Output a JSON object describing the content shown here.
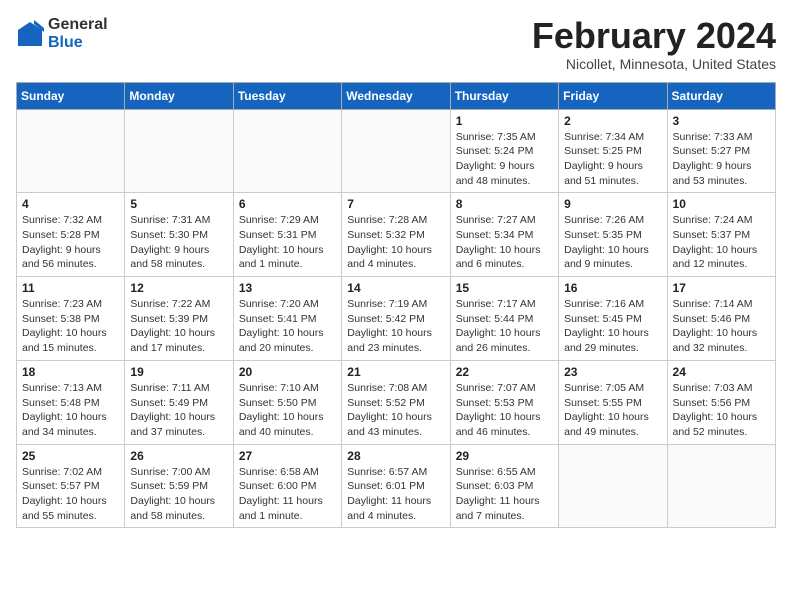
{
  "header": {
    "logo_general": "General",
    "logo_blue": "Blue",
    "month_title": "February 2024",
    "location": "Nicollet, Minnesota, United States"
  },
  "weekdays": [
    "Sunday",
    "Monday",
    "Tuesday",
    "Wednesday",
    "Thursday",
    "Friday",
    "Saturday"
  ],
  "weeks": [
    [
      {
        "day": "",
        "info": ""
      },
      {
        "day": "",
        "info": ""
      },
      {
        "day": "",
        "info": ""
      },
      {
        "day": "",
        "info": ""
      },
      {
        "day": "1",
        "info": "Sunrise: 7:35 AM\nSunset: 5:24 PM\nDaylight: 9 hours and 48 minutes."
      },
      {
        "day": "2",
        "info": "Sunrise: 7:34 AM\nSunset: 5:25 PM\nDaylight: 9 hours and 51 minutes."
      },
      {
        "day": "3",
        "info": "Sunrise: 7:33 AM\nSunset: 5:27 PM\nDaylight: 9 hours and 53 minutes."
      }
    ],
    [
      {
        "day": "4",
        "info": "Sunrise: 7:32 AM\nSunset: 5:28 PM\nDaylight: 9 hours and 56 minutes."
      },
      {
        "day": "5",
        "info": "Sunrise: 7:31 AM\nSunset: 5:30 PM\nDaylight: 9 hours and 58 minutes."
      },
      {
        "day": "6",
        "info": "Sunrise: 7:29 AM\nSunset: 5:31 PM\nDaylight: 10 hours and 1 minute."
      },
      {
        "day": "7",
        "info": "Sunrise: 7:28 AM\nSunset: 5:32 PM\nDaylight: 10 hours and 4 minutes."
      },
      {
        "day": "8",
        "info": "Sunrise: 7:27 AM\nSunset: 5:34 PM\nDaylight: 10 hours and 6 minutes."
      },
      {
        "day": "9",
        "info": "Sunrise: 7:26 AM\nSunset: 5:35 PM\nDaylight: 10 hours and 9 minutes."
      },
      {
        "day": "10",
        "info": "Sunrise: 7:24 AM\nSunset: 5:37 PM\nDaylight: 10 hours and 12 minutes."
      }
    ],
    [
      {
        "day": "11",
        "info": "Sunrise: 7:23 AM\nSunset: 5:38 PM\nDaylight: 10 hours and 15 minutes."
      },
      {
        "day": "12",
        "info": "Sunrise: 7:22 AM\nSunset: 5:39 PM\nDaylight: 10 hours and 17 minutes."
      },
      {
        "day": "13",
        "info": "Sunrise: 7:20 AM\nSunset: 5:41 PM\nDaylight: 10 hours and 20 minutes."
      },
      {
        "day": "14",
        "info": "Sunrise: 7:19 AM\nSunset: 5:42 PM\nDaylight: 10 hours and 23 minutes."
      },
      {
        "day": "15",
        "info": "Sunrise: 7:17 AM\nSunset: 5:44 PM\nDaylight: 10 hours and 26 minutes."
      },
      {
        "day": "16",
        "info": "Sunrise: 7:16 AM\nSunset: 5:45 PM\nDaylight: 10 hours and 29 minutes."
      },
      {
        "day": "17",
        "info": "Sunrise: 7:14 AM\nSunset: 5:46 PM\nDaylight: 10 hours and 32 minutes."
      }
    ],
    [
      {
        "day": "18",
        "info": "Sunrise: 7:13 AM\nSunset: 5:48 PM\nDaylight: 10 hours and 34 minutes."
      },
      {
        "day": "19",
        "info": "Sunrise: 7:11 AM\nSunset: 5:49 PM\nDaylight: 10 hours and 37 minutes."
      },
      {
        "day": "20",
        "info": "Sunrise: 7:10 AM\nSunset: 5:50 PM\nDaylight: 10 hours and 40 minutes."
      },
      {
        "day": "21",
        "info": "Sunrise: 7:08 AM\nSunset: 5:52 PM\nDaylight: 10 hours and 43 minutes."
      },
      {
        "day": "22",
        "info": "Sunrise: 7:07 AM\nSunset: 5:53 PM\nDaylight: 10 hours and 46 minutes."
      },
      {
        "day": "23",
        "info": "Sunrise: 7:05 AM\nSunset: 5:55 PM\nDaylight: 10 hours and 49 minutes."
      },
      {
        "day": "24",
        "info": "Sunrise: 7:03 AM\nSunset: 5:56 PM\nDaylight: 10 hours and 52 minutes."
      }
    ],
    [
      {
        "day": "25",
        "info": "Sunrise: 7:02 AM\nSunset: 5:57 PM\nDaylight: 10 hours and 55 minutes."
      },
      {
        "day": "26",
        "info": "Sunrise: 7:00 AM\nSunset: 5:59 PM\nDaylight: 10 hours and 58 minutes."
      },
      {
        "day": "27",
        "info": "Sunrise: 6:58 AM\nSunset: 6:00 PM\nDaylight: 11 hours and 1 minute."
      },
      {
        "day": "28",
        "info": "Sunrise: 6:57 AM\nSunset: 6:01 PM\nDaylight: 11 hours and 4 minutes."
      },
      {
        "day": "29",
        "info": "Sunrise: 6:55 AM\nSunset: 6:03 PM\nDaylight: 11 hours and 7 minutes."
      },
      {
        "day": "",
        "info": ""
      },
      {
        "day": "",
        "info": ""
      }
    ]
  ]
}
